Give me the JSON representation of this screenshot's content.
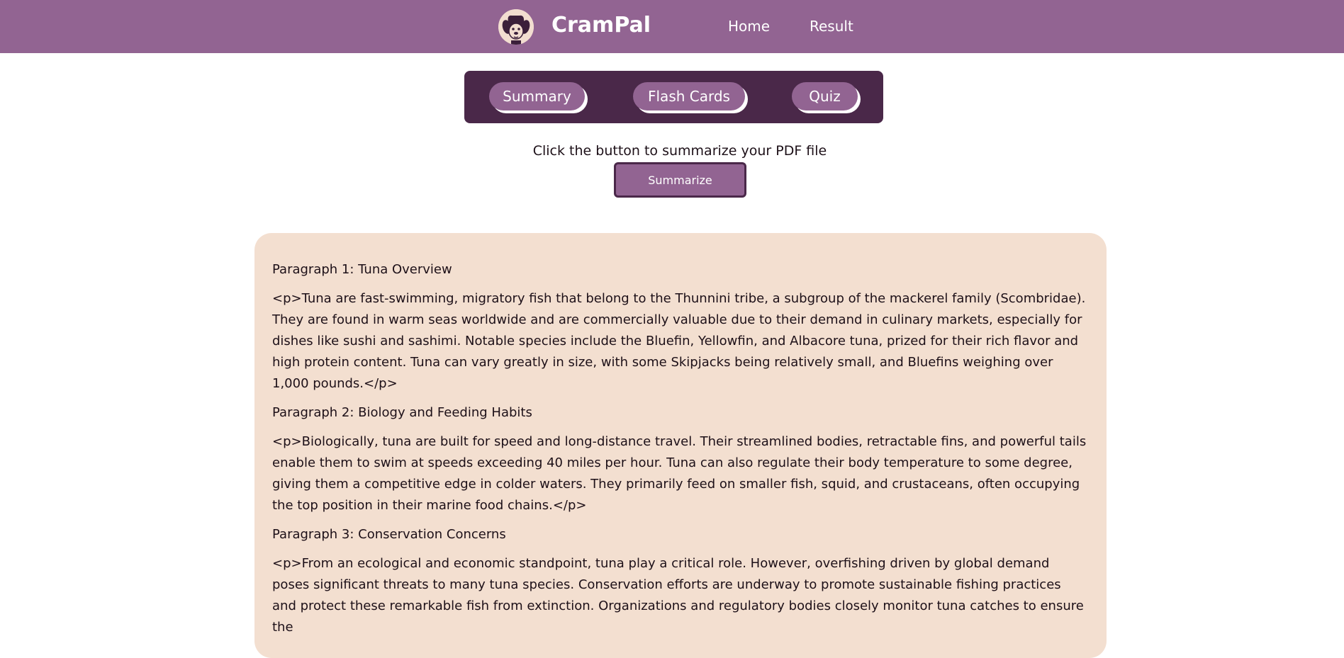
{
  "navbar": {
    "brand": "CramPal",
    "links": [
      "Home",
      "Result"
    ],
    "logo_icon": "dog-mascot-icon",
    "colors": {
      "navbar": "#926492",
      "logo_bg": "#f2ddd0"
    }
  },
  "tabs": {
    "items": [
      "Summary",
      "Flash Cards",
      "Quiz"
    ],
    "colors": {
      "bar": "#4a2849",
      "tab": "#926492"
    }
  },
  "summarize": {
    "instruction": "Click the button to summarize your PDF file",
    "button_label": "Summarize"
  },
  "summary": {
    "panel_color": "#f3dfd0",
    "paragraphs": [
      {
        "title": "Paragraph 1: Tuna Overview",
        "body": "<p>Tuna are fast-swimming, migratory fish that belong to the Thunnini tribe, a subgroup of the mackerel family (Scombridae). They are found in warm seas worldwide and are commercially valuable due to their demand in culinary markets, especially for dishes like sushi and sashimi. Notable species include the Bluefin, Yellowfin, and Albacore tuna, prized for their rich flavor and high protein content. Tuna can vary greatly in size, with some Skipjacks being relatively small, and Bluefins weighing over 1,000 pounds.</p>"
      },
      {
        "title": "Paragraph 2: Biology and Feeding Habits",
        "body": "<p>Biologically, tuna are built for speed and long-distance travel. Their streamlined bodies, retractable fins, and powerful tails enable them to swim at speeds exceeding 40 miles per hour. Tuna can also regulate their body temperature to some degree, giving them a competitive edge in colder waters. They primarily feed on smaller fish, squid, and crustaceans, often occupying the top position in their marine food chains.</p>"
      },
      {
        "title": "Paragraph 3: Conservation Concerns",
        "body": "<p>From an ecological and economic standpoint, tuna play a critical role. However, overfishing driven by global demand poses significant threats to many tuna species. Conservation efforts are underway to promote sustainable fishing practices and protect these remarkable fish from extinction. Organizations and regulatory bodies closely monitor tuna catches to ensure the"
      }
    ]
  }
}
